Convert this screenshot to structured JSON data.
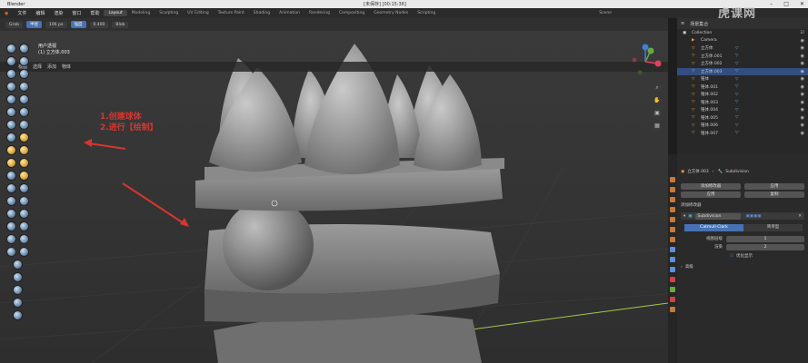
{
  "titlebar": {
    "app": "Blender",
    "file": "[未保存] [00:15:36]"
  },
  "menubar": {
    "items": [
      "文件",
      "编辑",
      "渲染",
      "窗口",
      "帮助"
    ],
    "workspaces": [
      "Layout",
      "Modeling",
      "Sculpting",
      "UV Editing",
      "Texture Paint",
      "Shading",
      "Animation",
      "Rendering",
      "Compositing",
      "Geometry Nodes",
      "Scripting"
    ],
    "scene": "Scene"
  },
  "tool_header": {
    "brush": "Grab",
    "radius_label": "半径",
    "radius": "106 px",
    "strength_label": "强度",
    "strength": "0.400",
    "mode_label": "Blob"
  },
  "view_header": {
    "items": [
      "视图",
      "选择",
      "添加",
      "物体"
    ]
  },
  "viewport": {
    "mode": "用户透视",
    "object": "(1) 立方体.003"
  },
  "annotation": {
    "line1": "1.创建球体",
    "line2": "2.进行【绘制】"
  },
  "outliner": {
    "title": "场景集合",
    "collection": "Collection",
    "rows": [
      {
        "name": "Camera",
        "sel": false
      },
      {
        "name": "立方体",
        "sel": false
      },
      {
        "name": "立方体.001",
        "sel": false
      },
      {
        "name": "立方体.002",
        "sel": false
      },
      {
        "name": "立方体.003",
        "sel": true
      },
      {
        "name": "锥体",
        "sel": false
      },
      {
        "name": "锥体.001",
        "sel": false
      },
      {
        "name": "锥体.002",
        "sel": false
      },
      {
        "name": "锥体.003",
        "sel": false
      },
      {
        "name": "锥体.004",
        "sel": false
      },
      {
        "name": "锥体.005",
        "sel": false
      },
      {
        "name": "锥体.006",
        "sel": false
      },
      {
        "name": "锥体.007",
        "sel": false
      }
    ]
  },
  "properties": {
    "breadcrumb": "立方体.003",
    "breadcrumb2": "Subdivision",
    "btn1": "添加修改器",
    "btn2": "应用",
    "btn3": "应用",
    "btn4": "复制",
    "section": "添加修改器",
    "modifier": "Subdivision",
    "tab_active": "Catmull-Clark",
    "tab_other": "简单型",
    "levels_viewport_label": "视图层级",
    "levels_viewport": "1",
    "render_label": "渲染",
    "render": "2",
    "optimal_label": "优化显示",
    "advanced": "高级"
  },
  "watermark": "虎课网"
}
